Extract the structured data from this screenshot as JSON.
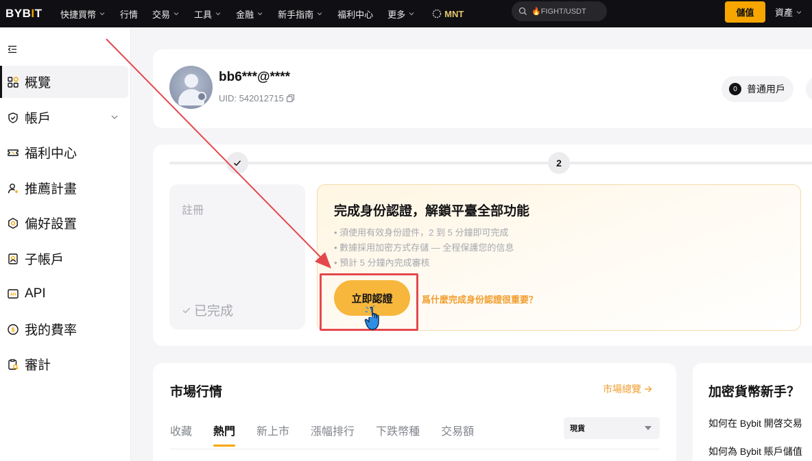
{
  "topbar": {
    "logo_main": "BYB",
    "logo_accent": "I",
    "logo_end": "T",
    "nav": [
      {
        "label": "快捷買幣",
        "dropdown": true
      },
      {
        "label": "行情",
        "dropdown": false
      },
      {
        "label": "交易",
        "dropdown": true
      },
      {
        "label": "工具",
        "dropdown": true
      },
      {
        "label": "金融",
        "dropdown": true
      },
      {
        "label": "新手指南",
        "dropdown": true
      },
      {
        "label": "福利中心",
        "dropdown": false
      },
      {
        "label": "更多",
        "dropdown": true
      }
    ],
    "mnt_label": "MNT",
    "search_placeholder": "🔥FIGHT/USDT",
    "deposit_label": "儲值",
    "assets_label": "資產"
  },
  "sidebar": {
    "items": [
      {
        "label": "概覽",
        "icon": "grid-icon"
      },
      {
        "label": "帳戶",
        "icon": "shield-icon"
      },
      {
        "label": "福利中心",
        "icon": "ticket-icon"
      },
      {
        "label": "推薦計畫",
        "icon": "user-add-icon"
      },
      {
        "label": "偏好設置",
        "icon": "gear-icon"
      },
      {
        "label": "子帳戶",
        "icon": "id-card-icon"
      },
      {
        "label": "API",
        "icon": "api-icon"
      },
      {
        "label": "我的費率",
        "icon": "coin-icon"
      },
      {
        "label": "審計",
        "icon": "audit-icon"
      }
    ]
  },
  "profile": {
    "username": "bb6***@****",
    "uid": "UID: 542012715",
    "account_level_badge": "0",
    "account_type": "普通用戶"
  },
  "verification": {
    "step_two": "2",
    "register_title": "註冊",
    "register_status": "已完成",
    "kyc_title": "完成身份認證，解鎖平臺全部功能",
    "kyc_points": [
      "須使用有效身份證件，2 到 5 分鐘即可完成",
      "數據採用加密方式存儲 — 全程保護您的信息",
      "預計 5 分鐘內完成審核"
    ],
    "verify_button": "立即認證",
    "why_link": "爲什麼完成身份認證很重要？"
  },
  "market": {
    "title": "市場行情",
    "overview_link": "市場總覽",
    "tabs": [
      "收藏",
      "熱門",
      "新上市",
      "漲幅排行",
      "下跌幣種",
      "交易額"
    ],
    "active_tab": 1,
    "spot_select": "現貨"
  },
  "newbie": {
    "title": "加密貨幣新手？",
    "links": [
      "如何在 Bybit 開啓交易",
      "如何為 Bybit 賬戶儲值"
    ]
  },
  "colors": {
    "brand": "#f7a600",
    "link": "#f29d2b",
    "highlight": "#e4484d"
  }
}
